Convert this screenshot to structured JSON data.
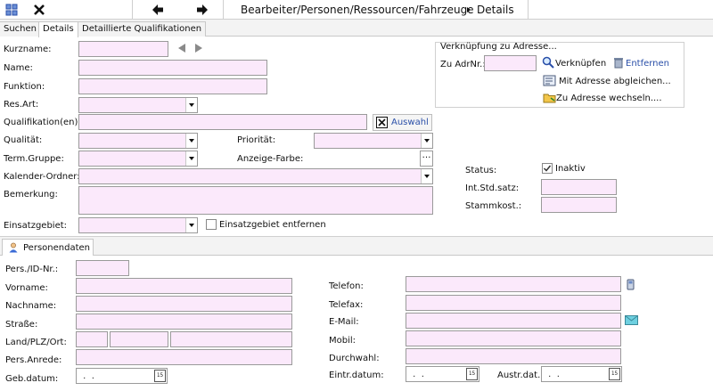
{
  "toolbar": {
    "breadcrumb_path": "Bearbeiter/Personen/Ressourcen/Fahrzeuge",
    "breadcrumb_current": "Details"
  },
  "tabs": [
    {
      "label": "Suchen"
    },
    {
      "label": "Details"
    },
    {
      "label": "Detaillierte Qualifikationen"
    }
  ],
  "form": {
    "kurzname_label": "Kurzname:",
    "name_label": "Name:",
    "funktion_label": "Funktion:",
    "resart_label": "Res.Art:",
    "qualifikationen_label": "Qualifikation(en):",
    "auswahl_label": "Auswahl",
    "qualitaet_label": "Qualität:",
    "prioritaet_label": "Priorität:",
    "termgruppe_label": "Term.Gruppe:",
    "anzeigefarbe_label": "Anzeige-Farbe:",
    "kalenderordner_label": "Kalender-Ordner:",
    "bemerkung_label": "Bemerkung:",
    "einsatzgebiet_label": "Einsatzgebiet:",
    "einsatzgebiet_entfernen_label": "Einsatzgebiet entfernen"
  },
  "address_group": {
    "title": "Verknüpfung zu Adresse...",
    "adrnr_label": "Zu AdrNr.:",
    "verknuepfen_label": "Verknüpfen",
    "entfernen_label": "Entfernen",
    "abgleichen_label": "Mit Adresse abgleichen...",
    "wechseln_label": "Zu Adresse wechseln...."
  },
  "status": {
    "status_label": "Status:",
    "inaktiv_label": "Inaktiv",
    "inaktiv_checked": true,
    "intstdsatz_label": "Int.Std.satz:",
    "stammkost_label": "Stammkost.:"
  },
  "personendaten": {
    "tab_label": "Personendaten",
    "persid_label": "Pers./ID-Nr.:",
    "vorname_label": "Vorname:",
    "nachname_label": "Nachname:",
    "strasse_label": "Straße:",
    "landplzort_label": "Land/PLZ/Ort:",
    "persanrede_label": "Pers.Anrede:",
    "gebdatum_label": "Geb.datum:",
    "gebdatum_value": " .  .",
    "telefon_label": "Telefon:",
    "telefax_label": "Telefax:",
    "email_label": "E-Mail:",
    "mobil_label": "Mobil:",
    "durchwahl_label": "Durchwahl:",
    "eintrdatum_label": "Eintr.datum:",
    "eintrdatum_value": " .  .",
    "austrdat_label": "Austr.dat.:",
    "austrdat_value": " .  .",
    "date_button_label": "15"
  },
  "colors": {
    "field_bg": "#fbe9fb",
    "accent": "#2a4fa8"
  }
}
